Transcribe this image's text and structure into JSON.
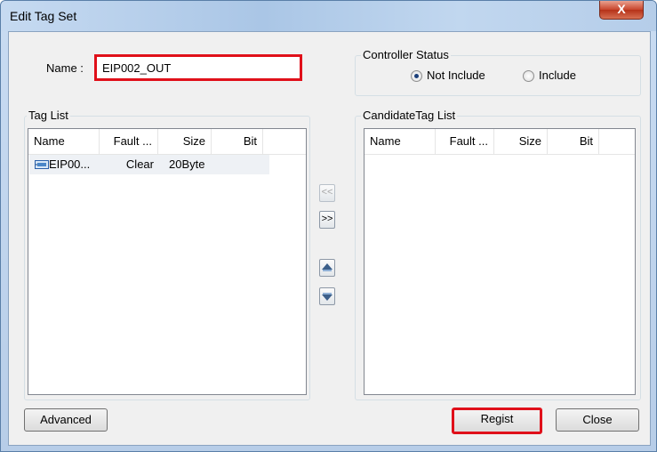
{
  "window": {
    "title": "Edit Tag Set",
    "close_glyph": "X"
  },
  "name_field": {
    "label": "Name :",
    "value": "EIP002_OUT"
  },
  "controller_status": {
    "title": "Controller Status",
    "options": [
      {
        "label": "Not Include",
        "selected": true
      },
      {
        "label": "Include",
        "selected": false
      }
    ]
  },
  "tag_list": {
    "title": "Tag List",
    "columns": [
      "Name",
      "Fault ...",
      "Size",
      "Bit"
    ],
    "rows": [
      {
        "name": "EIP00...",
        "fault": "Clear",
        "size": "20Byte",
        "bit": "",
        "icon": "tag-icon"
      }
    ]
  },
  "candidate_tag_list": {
    "title": "CandidateTag List",
    "columns": [
      "Name",
      "Fault ...",
      "Size",
      "Bit"
    ],
    "rows": []
  },
  "transfer": {
    "move_left": "<<",
    "move_right": ">>",
    "move_up_icon": "move-up-icon",
    "move_down_icon": "move-down-icon"
  },
  "buttons": {
    "advanced": "Advanced",
    "regist": "Regist",
    "close": "Close"
  },
  "colors": {
    "highlight": "#e0101a",
    "selected_row": "#eef1f5"
  }
}
